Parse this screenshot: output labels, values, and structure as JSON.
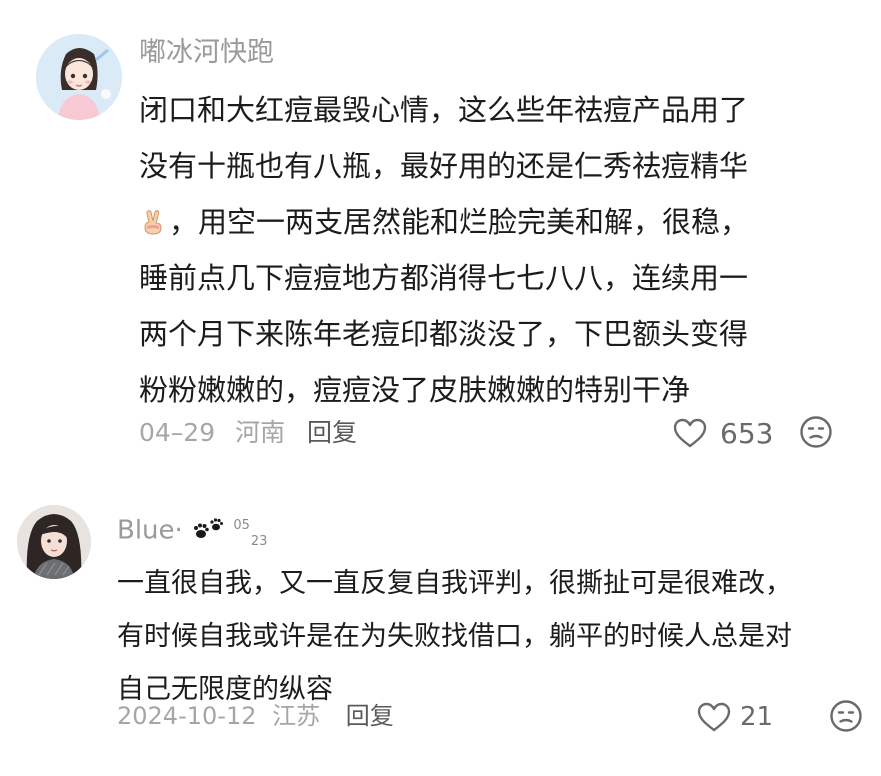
{
  "comments": [
    {
      "username": "嘟冰河快跑",
      "lines": [
        "闭口和大红痘最毁心情，这么些年祛痘产品用了",
        "没有十瓶也有八瓶，最好用的还是仁秀祛痘精华",
        "，用空一两支居然能和烂脸完美和解，很稳，",
        "睡前点几下痘痘地方都消得七七八八，连续用一",
        "两个月下来陈年老痘印都淡没了，下巴额头变得",
        "粉粉嫩嫩的，痘痘没了皮肤嫩嫩的特别干净"
      ],
      "inline_emoji": "victory-hand-emoji",
      "date": "04–29",
      "location": "河南",
      "reply_label": "回复",
      "like_count": "653",
      "icons": {
        "like": "heart-outline-icon",
        "dislike": "unhappy-face-icon"
      }
    },
    {
      "username": "Blue·",
      "badge_icon": "paw-prints-icon",
      "badge_sup": "05",
      "badge_sub": "23",
      "lines": [
        "一直很自我，又一直反复自我评判，很撕扯可是很难改，",
        "有时候自我或许是在为失败找借口，躺平的时候人总是对",
        "自己无限度的纵容"
      ],
      "date": "2024-10-12",
      "location": "江苏",
      "reply_label": "回复",
      "like_count": "21",
      "icons": {
        "like": "heart-outline-icon",
        "dislike": "unhappy-face-icon"
      }
    }
  ],
  "colors": {
    "username": "#9a9a9a",
    "body": "#1c1c1c",
    "meta": "#a6a6a6",
    "reply": "#5a5a5a",
    "icon": "#6a6a6a"
  }
}
